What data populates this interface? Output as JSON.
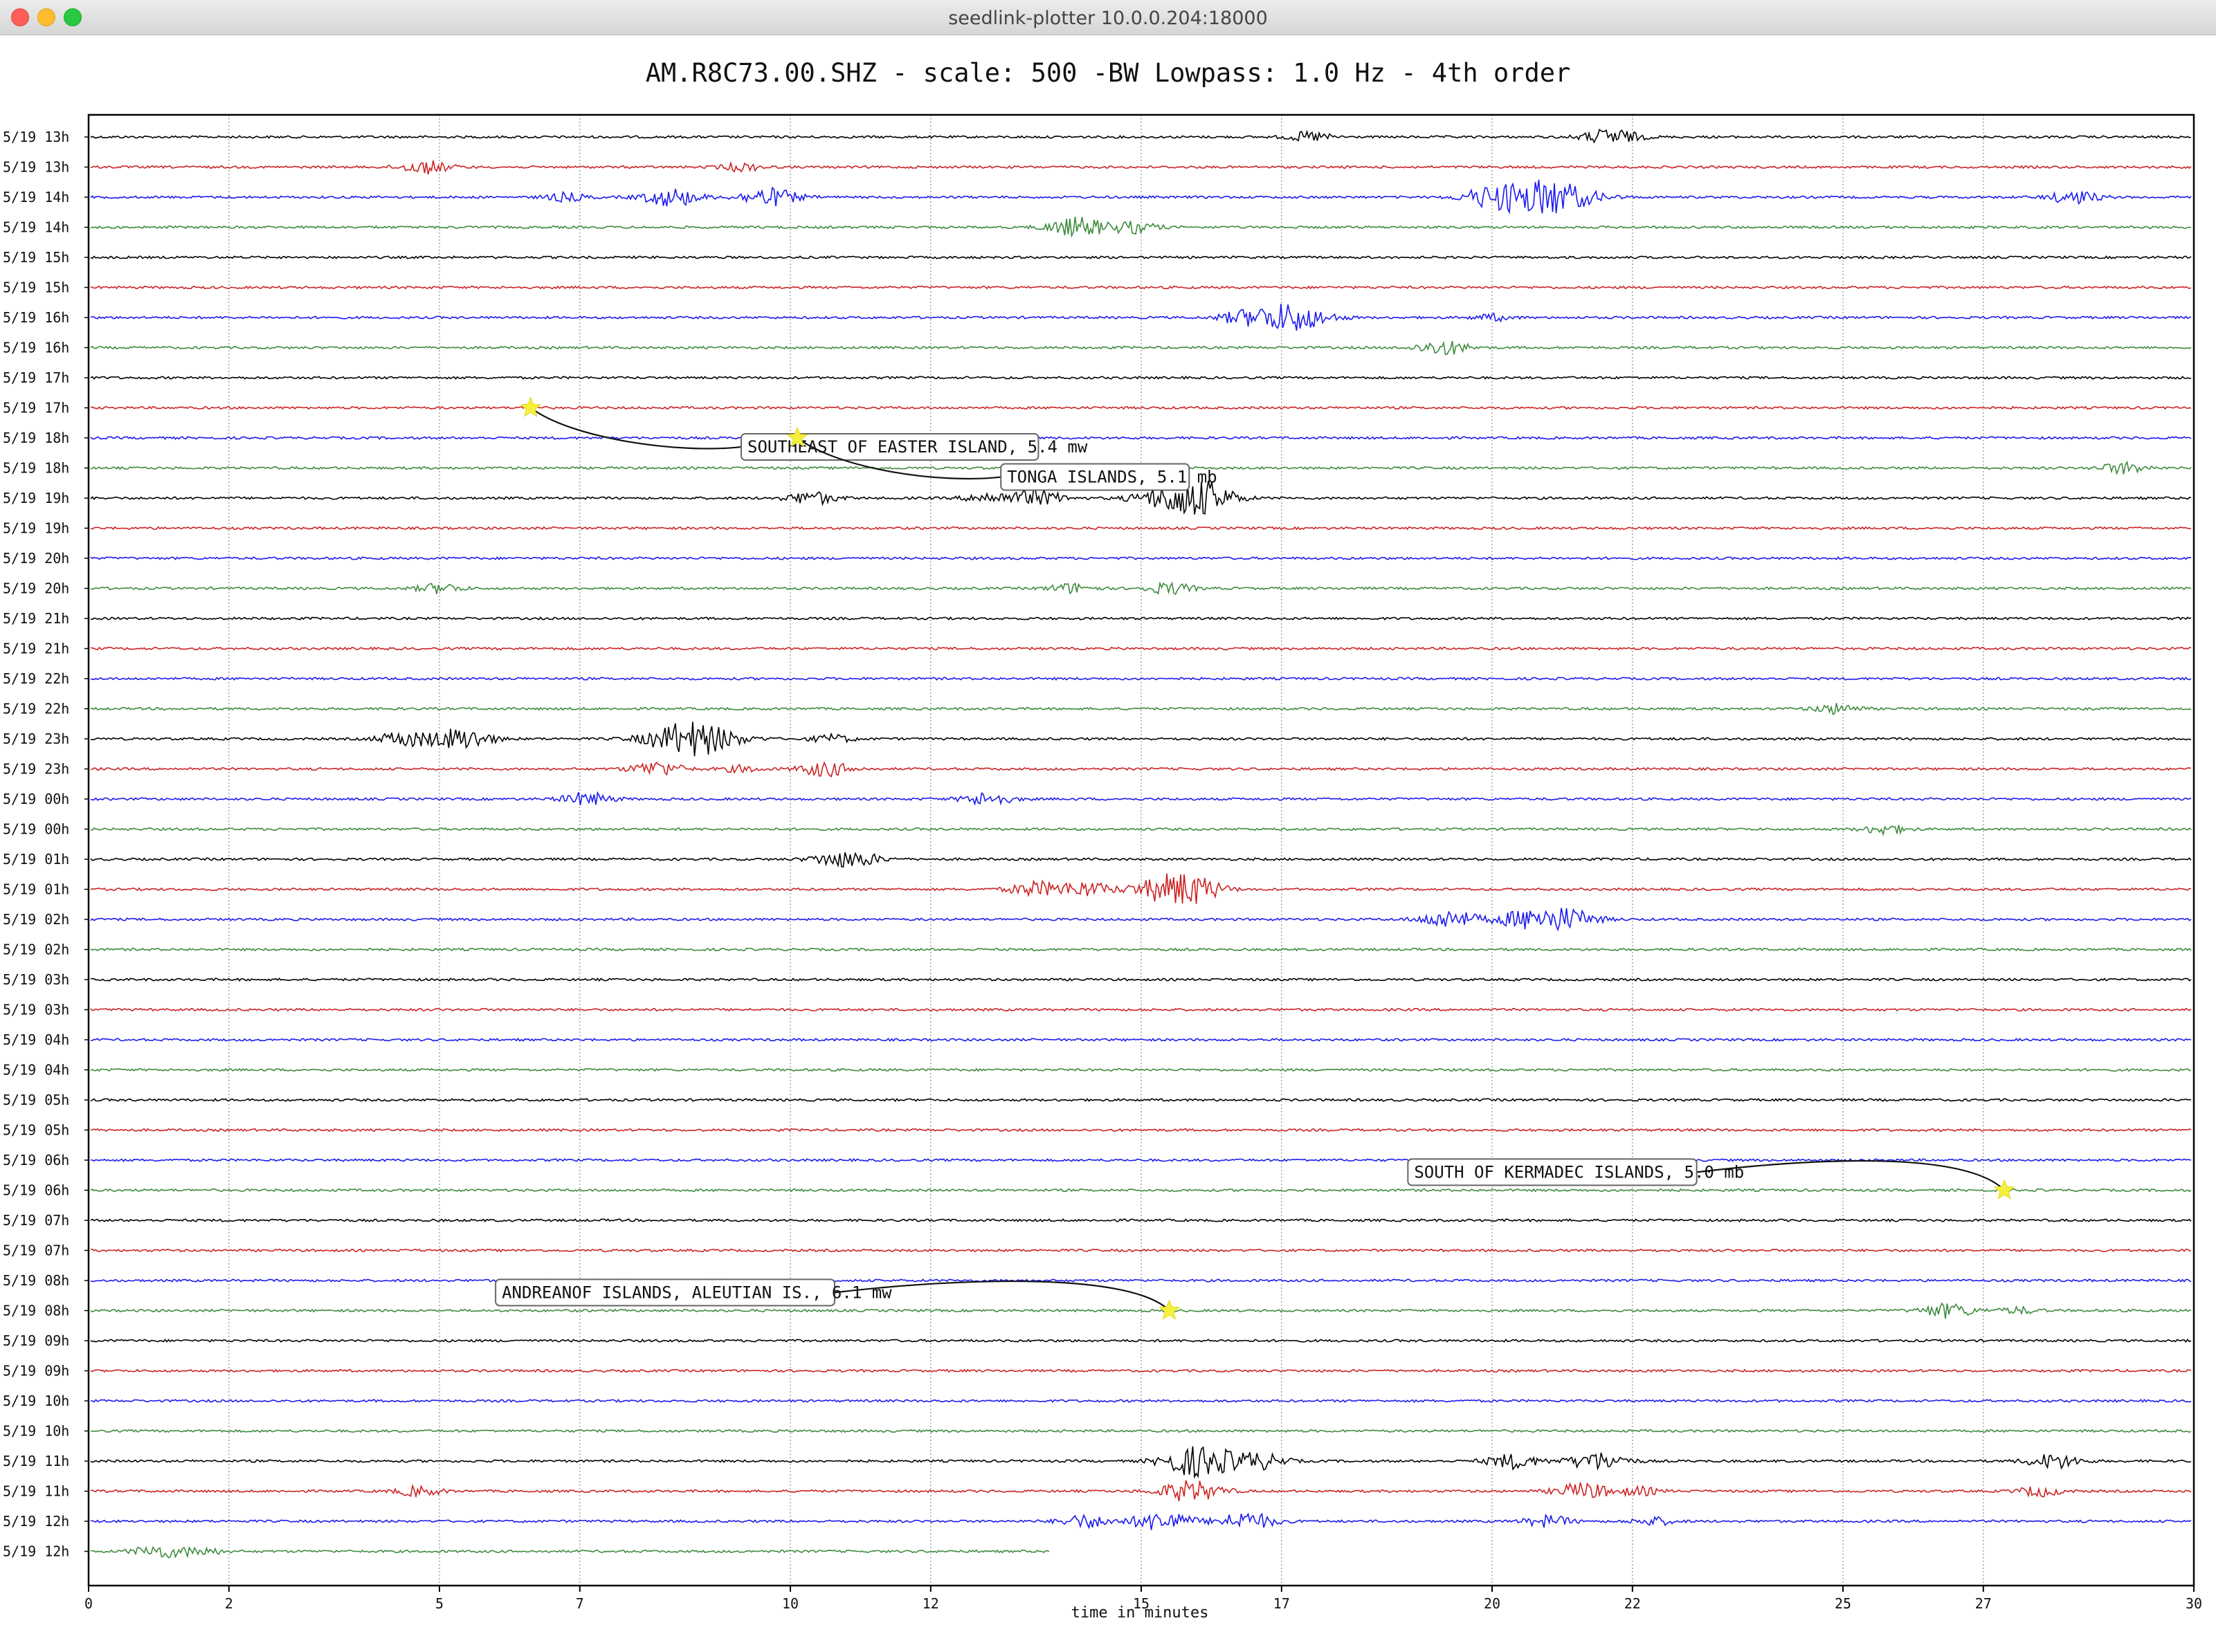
{
  "window": {
    "title": "seedlink-plotter 10.0.0.204:18000"
  },
  "colors": {
    "trace_cycle": [
      "#000000",
      "#cc2222",
      "#1a1aee",
      "#3d8a3d"
    ],
    "event_star": "#f5f03c"
  },
  "chart_data": {
    "type": "line",
    "title": "AM.R8C73.00.SHZ - scale: 500 -BW Lowpass: 1.0 Hz - 4th order",
    "xlabel": "time in minutes",
    "xlim": [
      0,
      30
    ],
    "x_ticks": [
      0,
      2,
      5,
      7,
      10,
      12,
      15,
      17,
      20,
      22,
      25,
      27,
      30
    ],
    "grid": "vertical dotted lines at each tick",
    "row_labels": [
      "5/19 13h",
      "5/19 13h",
      "5/19 14h",
      "5/19 14h",
      "5/19 15h",
      "5/19 15h",
      "5/19 16h",
      "5/19 16h",
      "5/19 17h",
      "5/19 17h",
      "5/19 18h",
      "5/19 18h",
      "5/19 19h",
      "5/19 19h",
      "5/19 20h",
      "5/19 20h",
      "5/19 21h",
      "5/19 21h",
      "5/19 22h",
      "5/19 22h",
      "5/19 23h",
      "5/19 23h",
      "5/19 00h",
      "5/19 00h",
      "5/19 01h",
      "5/19 01h",
      "5/19 02h",
      "5/19 02h",
      "5/19 03h",
      "5/19 03h",
      "5/19 04h",
      "5/19 04h",
      "5/19 05h",
      "5/19 05h",
      "5/19 06h",
      "5/19 06h",
      "5/19 07h",
      "5/19 07h",
      "5/19 08h",
      "5/19 08h",
      "5/19 09h",
      "5/19 09h",
      "5/19 10h",
      "5/19 10h",
      "5/19 11h",
      "5/19 11h",
      "5/19 12h",
      "5/19 12h"
    ],
    "last_row_end_minute": 13.7,
    "bursts": [
      {
        "row": 0,
        "minute": 17.4,
        "amplitude": 6
      },
      {
        "row": 0,
        "minute": 21.7,
        "amplitude": 10
      },
      {
        "row": 1,
        "minute": 4.8,
        "amplitude": 8
      },
      {
        "row": 1,
        "minute": 9.3,
        "amplitude": 5
      },
      {
        "row": 2,
        "minute": 6.8,
        "amplitude": 5
      },
      {
        "row": 2,
        "minute": 8.3,
        "amplitude": 11
      },
      {
        "row": 2,
        "minute": 9.7,
        "amplitude": 11
      },
      {
        "row": 2,
        "minute": 20.0,
        "amplitude": 12
      },
      {
        "row": 2,
        "minute": 20.8,
        "amplitude": 22
      },
      {
        "row": 2,
        "minute": 28.3,
        "amplitude": 8
      },
      {
        "row": 3,
        "minute": 14.1,
        "amplitude": 12
      },
      {
        "row": 3,
        "minute": 14.9,
        "amplitude": 7
      },
      {
        "row": 6,
        "minute": 17.1,
        "amplitude": 18
      },
      {
        "row": 6,
        "minute": 16.4,
        "amplitude": 6
      },
      {
        "row": 6,
        "minute": 20.0,
        "amplitude": 4
      },
      {
        "row": 7,
        "minute": 19.3,
        "amplitude": 9
      },
      {
        "row": 11,
        "minute": 29.0,
        "amplitude": 7
      },
      {
        "row": 12,
        "minute": 10.3,
        "amplitude": 8
      },
      {
        "row": 12,
        "minute": 12.8,
        "amplitude": 6
      },
      {
        "row": 12,
        "minute": 13.5,
        "amplitude": 10
      },
      {
        "row": 12,
        "minute": 15.6,
        "amplitude": 20
      },
      {
        "row": 12,
        "minute": 16.0,
        "amplitude": 8
      },
      {
        "row": 15,
        "minute": 5.0,
        "amplitude": 6
      },
      {
        "row": 15,
        "minute": 14.0,
        "amplitude": 6
      },
      {
        "row": 15,
        "minute": 15.4,
        "amplitude": 7
      },
      {
        "row": 19,
        "minute": 24.9,
        "amplitude": 6
      },
      {
        "row": 20,
        "minute": 4.5,
        "amplitude": 9
      },
      {
        "row": 20,
        "minute": 5.3,
        "amplitude": 13
      },
      {
        "row": 20,
        "minute": 8.6,
        "amplitude": 22
      },
      {
        "row": 20,
        "minute": 10.6,
        "amplitude": 5
      },
      {
        "row": 21,
        "minute": 8.1,
        "amplitude": 9
      },
      {
        "row": 21,
        "minute": 10.5,
        "amplitude": 9
      },
      {
        "row": 21,
        "minute": 9.3,
        "amplitude": 4
      },
      {
        "row": 22,
        "minute": 7.1,
        "amplitude": 8
      },
      {
        "row": 22,
        "minute": 12.8,
        "amplitude": 8
      },
      {
        "row": 23,
        "minute": 25.6,
        "amplitude": 6
      },
      {
        "row": 24,
        "minute": 10.6,
        "amplitude": 7
      },
      {
        "row": 24,
        "minute": 11.0,
        "amplitude": 7
      },
      {
        "row": 25,
        "minute": 13.5,
        "amplitude": 9
      },
      {
        "row": 25,
        "minute": 14.2,
        "amplitude": 9
      },
      {
        "row": 25,
        "minute": 15.4,
        "amplitude": 16
      },
      {
        "row": 25,
        "minute": 15.8,
        "amplitude": 10
      },
      {
        "row": 26,
        "minute": 19.4,
        "amplitude": 11
      },
      {
        "row": 26,
        "minute": 20.4,
        "amplitude": 9
      },
      {
        "row": 26,
        "minute": 21.0,
        "amplitude": 14
      },
      {
        "row": 39,
        "minute": 26.5,
        "amplitude": 9
      },
      {
        "row": 39,
        "minute": 27.5,
        "amplitude": 4
      },
      {
        "row": 44,
        "minute": 15.6,
        "amplitude": 10
      },
      {
        "row": 44,
        "minute": 16.0,
        "amplitude": 14
      },
      {
        "row": 44,
        "minute": 16.7,
        "amplitude": 9
      },
      {
        "row": 44,
        "minute": 20.3,
        "amplitude": 9
      },
      {
        "row": 44,
        "minute": 21.5,
        "amplitude": 11
      },
      {
        "row": 44,
        "minute": 28.0,
        "amplitude": 9
      },
      {
        "row": 45,
        "minute": 4.7,
        "amplitude": 6
      },
      {
        "row": 45,
        "minute": 15.7,
        "amplitude": 13
      },
      {
        "row": 45,
        "minute": 21.3,
        "amplitude": 10
      },
      {
        "row": 45,
        "minute": 22.1,
        "amplitude": 5
      },
      {
        "row": 45,
        "minute": 27.8,
        "amplitude": 6
      },
      {
        "row": 46,
        "minute": 14.2,
        "amplitude": 8
      },
      {
        "row": 46,
        "minute": 15.3,
        "amplitude": 12
      },
      {
        "row": 46,
        "minute": 16.5,
        "amplitude": 11
      },
      {
        "row": 46,
        "minute": 20.8,
        "amplitude": 7
      },
      {
        "row": 46,
        "minute": 22.3,
        "amplitude": 5
      },
      {
        "row": 47,
        "minute": 1.0,
        "amplitude": 8
      },
      {
        "row": 47,
        "minute": 1.6,
        "amplitude": 5
      }
    ],
    "annotations": [
      {
        "text": "SOUTHEAST OF EASTER ISLAND, 5.4 mw",
        "star_row": 9,
        "star_minute": 6.3,
        "label_row": 10.3,
        "label_minute": 9.3
      },
      {
        "text": "TONGA ISLANDS, 5.1 mb",
        "star_row": 10,
        "star_minute": 10.1,
        "label_row": 11.3,
        "label_minute": 13.0
      },
      {
        "text": "SOUTH OF KERMADEC ISLANDS, 5.0 mb",
        "star_row": 35,
        "star_minute": 27.3,
        "label_row": 34.4,
        "label_minute": 18.8
      },
      {
        "text": "ANDREANOF ISLANDS, ALEUTIAN IS., 6.1 mw",
        "star_row": 39,
        "star_minute": 15.4,
        "label_row": 38.4,
        "label_minute": 5.8
      }
    ]
  }
}
